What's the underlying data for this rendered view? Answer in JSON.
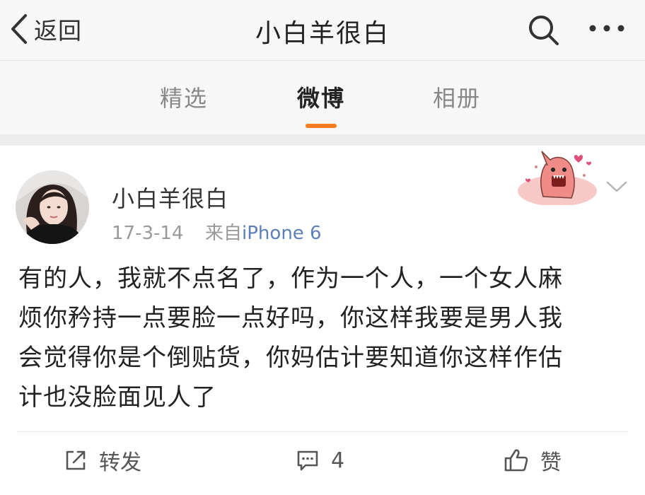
{
  "navbar": {
    "back_label": "返回",
    "title": "小白羊很白",
    "search_icon": "search-icon",
    "more_icon": "more-icon"
  },
  "tabs": [
    {
      "label": "精选",
      "active": false
    },
    {
      "label": "微博",
      "active": true
    },
    {
      "label": "相册",
      "active": false
    }
  ],
  "colors": {
    "accent": "#f57c1f",
    "link": "#5b7fb7",
    "muted": "#999999"
  },
  "post": {
    "author": "小白羊很白",
    "date": "17-3-14",
    "source_prefix": "来自",
    "source": "iPhone 6",
    "text_lines": [
      "有的人，我就不点名了，作为一个人，一个女人麻",
      "烦你矜持一点要脸一点好吗，你这样我要是男人我",
      "会觉得你是个倒贴货，你妈估计要知道你这样作估",
      "计也没脸面见人了"
    ],
    "actions": {
      "repost_label": "转发",
      "comment_count": "4",
      "like_label": "赞"
    }
  }
}
